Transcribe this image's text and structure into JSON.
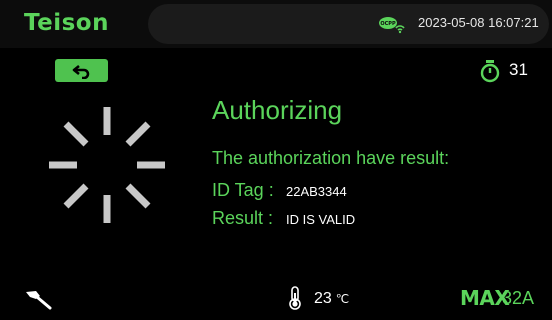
{
  "header": {
    "brand": "Teison",
    "datetime": "2023-05-08 16:07:21",
    "ocpp_icon": "ocpp-wifi-icon"
  },
  "toolbar": {
    "back_icon": "back-arrow-icon",
    "timer_icon": "stopwatch-icon",
    "countdown": "31"
  },
  "main": {
    "spinner_icon": "loading-spinner-icon",
    "title": "Authorizing",
    "message": "The authorization have result:",
    "rows": [
      {
        "label": "ID Tag : ",
        "value": "22AB3344"
      },
      {
        "label": "Result : ",
        "value": "ID IS VALID"
      }
    ]
  },
  "footer": {
    "plug_icon": "charging-plug-icon",
    "thermo_icon": "thermometer-icon",
    "temperature": "23",
    "temperature_unit": "℃",
    "max_label": "MAX",
    "max_value": "32A"
  },
  "colors": {
    "accent": "#5bd45b",
    "background": "#000000",
    "spinner": "#c8c8c8"
  }
}
